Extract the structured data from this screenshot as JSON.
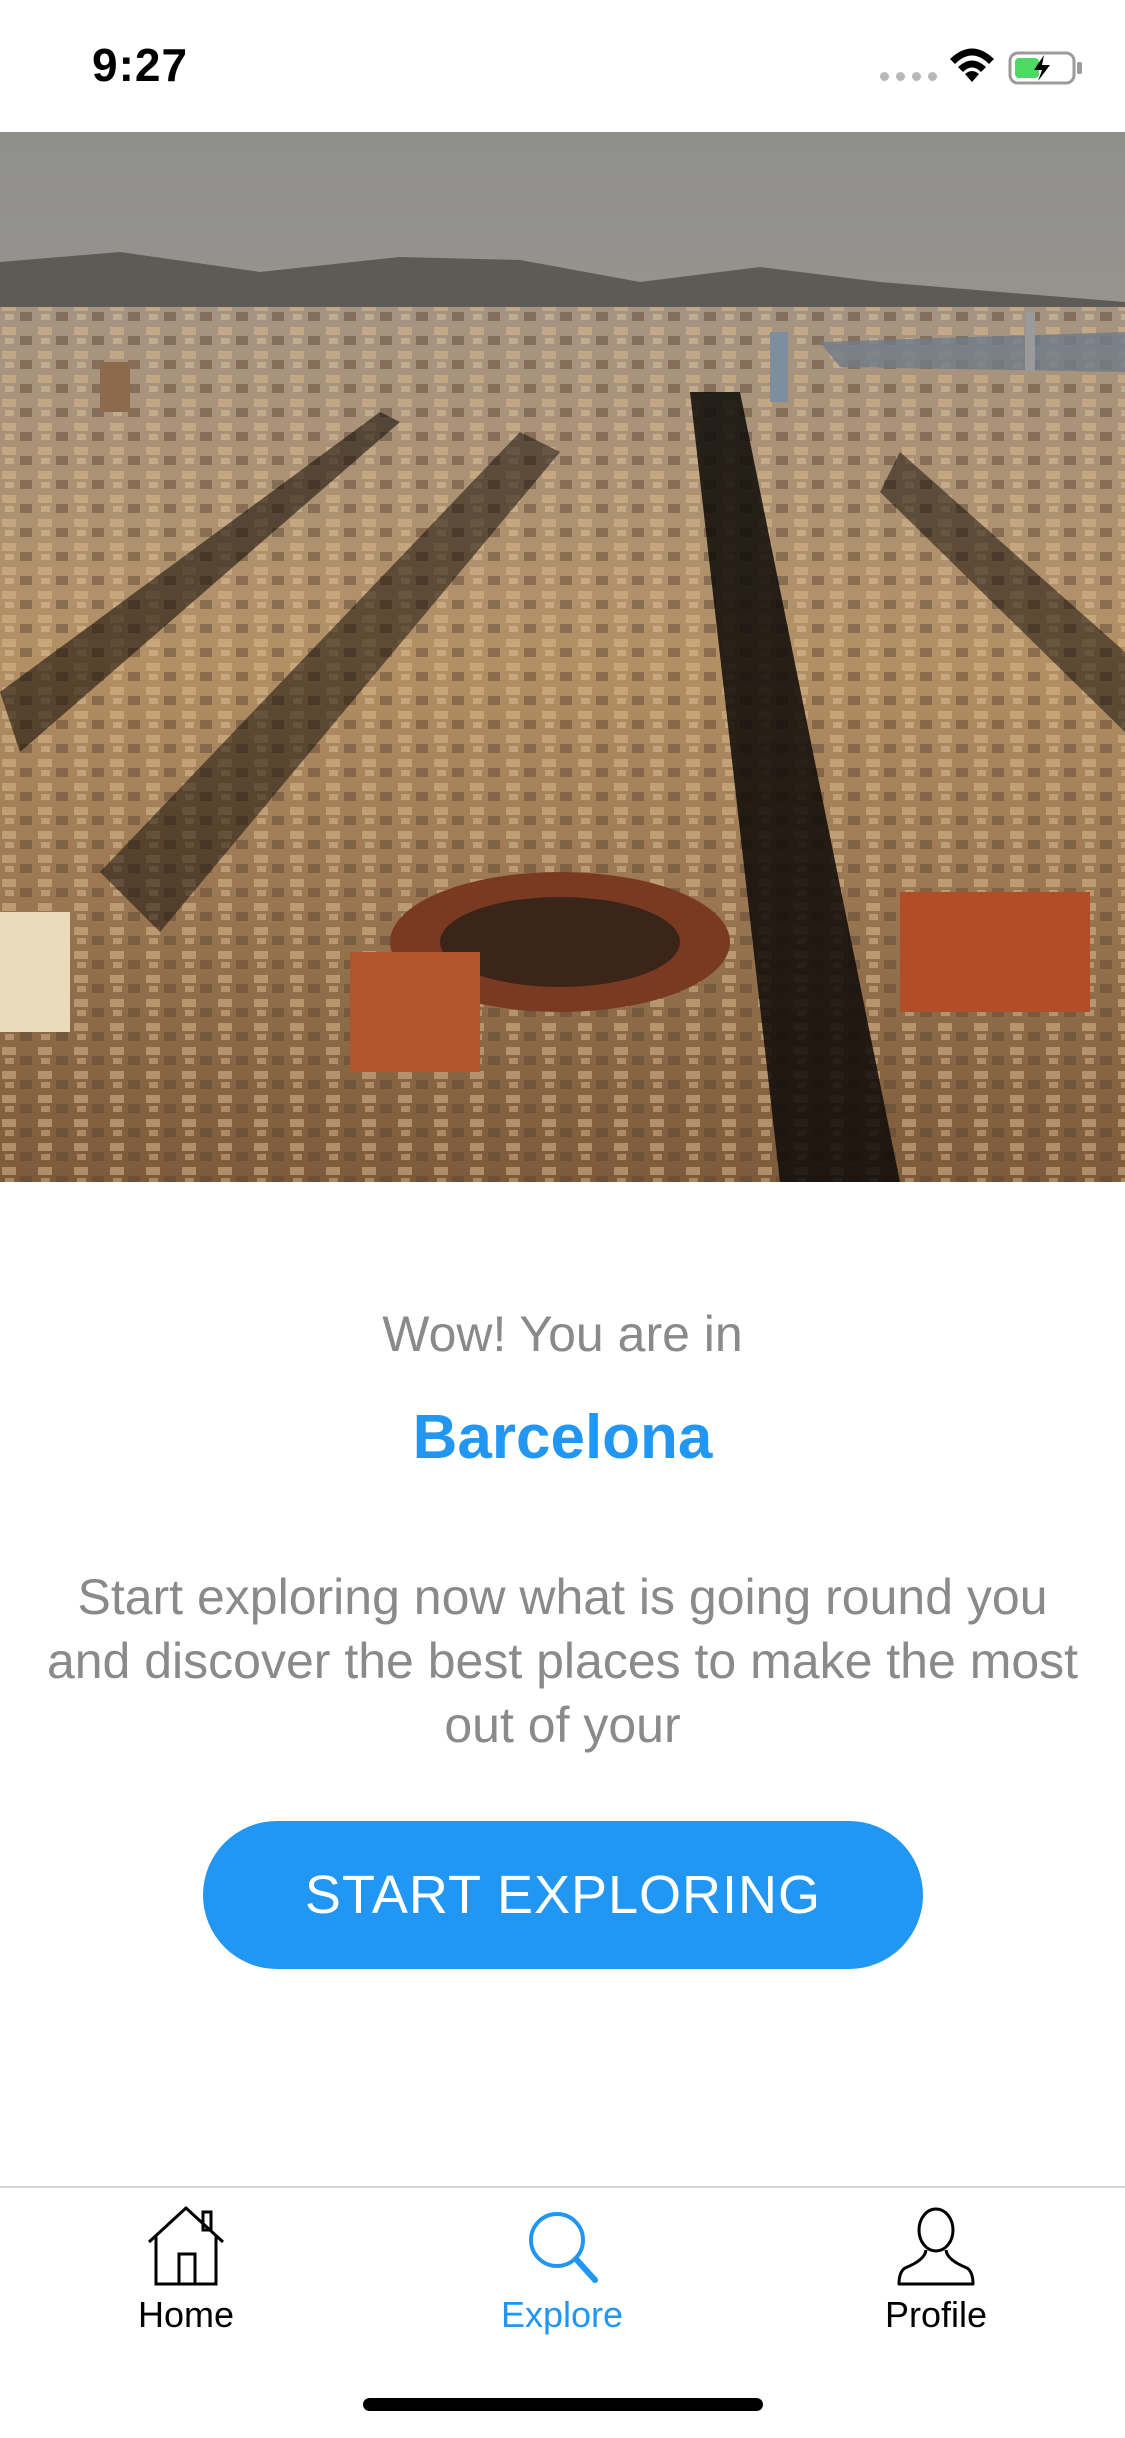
{
  "status_bar": {
    "time": "9:27"
  },
  "hero": {
    "image": "barcelona-aerial-city-photo"
  },
  "content": {
    "subtitle": "Wow! You are in",
    "city": "Barcelona",
    "description": "Start exploring now what is going round you and discover the best places to make the most out of your",
    "cta_label": "START EXPLORING"
  },
  "tabs": [
    {
      "label": "Home",
      "icon": "home-icon",
      "active": false
    },
    {
      "label": "Explore",
      "icon": "search-icon",
      "active": true
    },
    {
      "label": "Profile",
      "icon": "profile-icon",
      "active": false
    }
  ],
  "colors": {
    "accent": "#2196f3",
    "text_muted": "#8a8a8a",
    "battery_charge": "#4cd964"
  }
}
